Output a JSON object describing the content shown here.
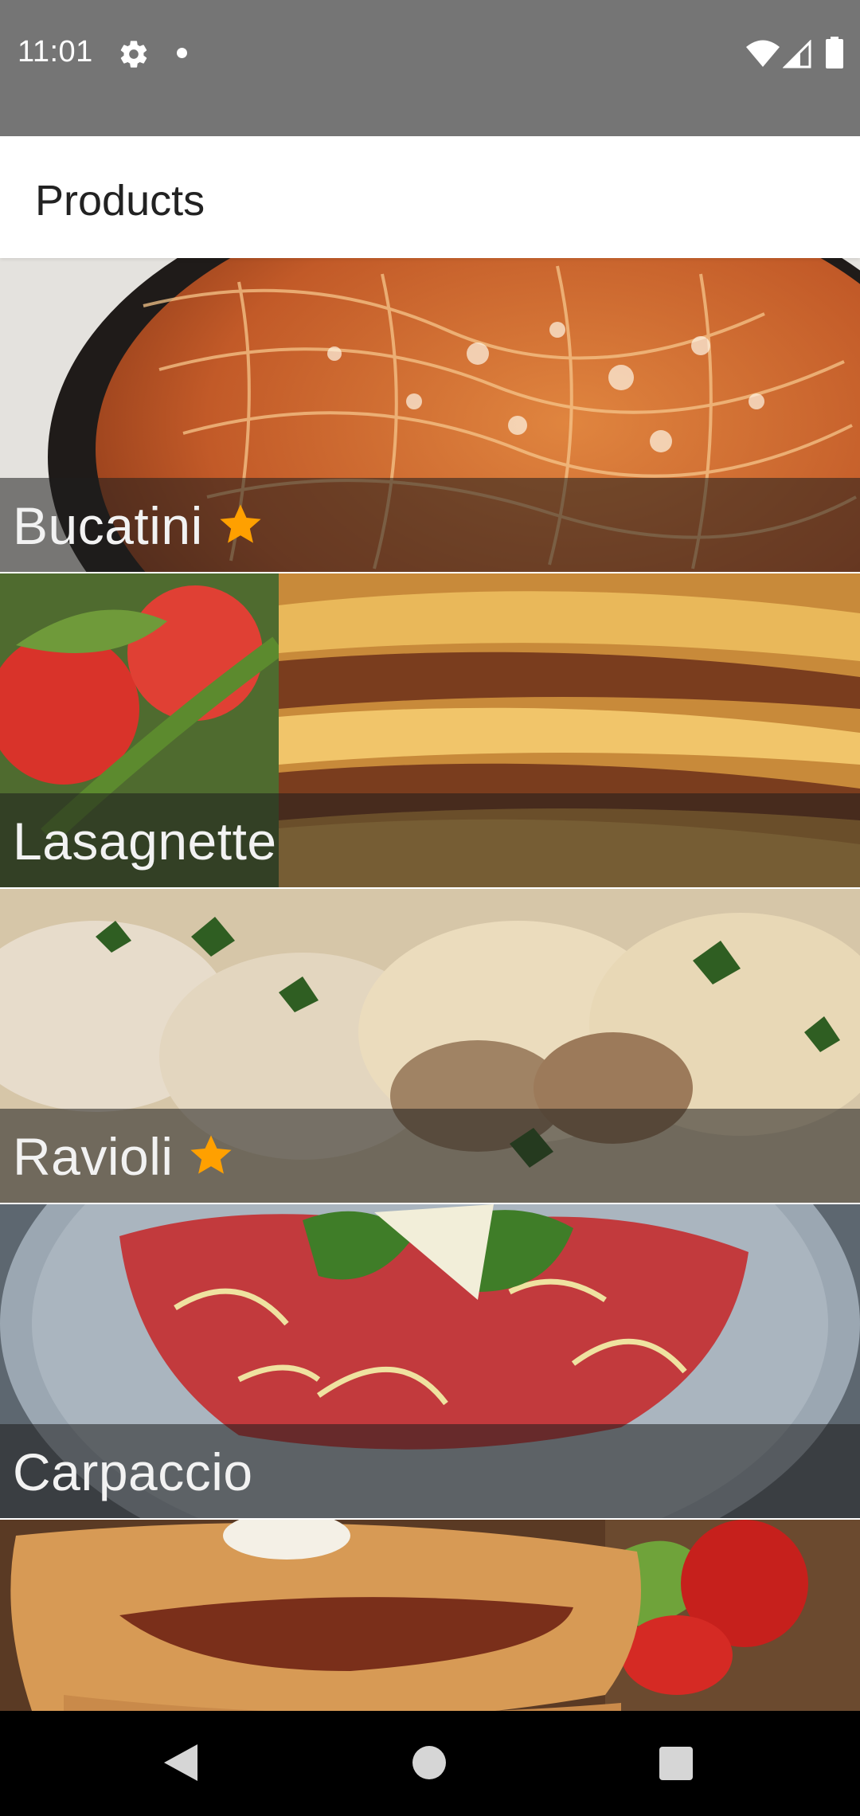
{
  "status_bar": {
    "time": "11:01",
    "icons": [
      "gear-icon",
      "notification-dot-icon",
      "wifi-icon",
      "cell-signal-icon",
      "battery-icon"
    ]
  },
  "app_bar": {
    "title": "Products"
  },
  "products": [
    {
      "name": "Bucatini",
      "favorite": true,
      "image": "spaghetti-bolognese-photo"
    },
    {
      "name": "Lasagnette",
      "favorite": false,
      "image": "lasagna-photo"
    },
    {
      "name": "Ravioli",
      "favorite": true,
      "image": "ravioli-photo"
    },
    {
      "name": "Carpaccio",
      "favorite": false,
      "image": "carpaccio-photo"
    },
    {
      "name": "",
      "favorite": false,
      "image": "calzone-photo"
    }
  ],
  "colors": {
    "status_bar": "#757575",
    "star": "#FFA000",
    "caption_overlay": "#1E1E1E"
  },
  "nav_bar": {
    "icons": [
      "back-icon",
      "home-icon",
      "recents-icon"
    ]
  }
}
